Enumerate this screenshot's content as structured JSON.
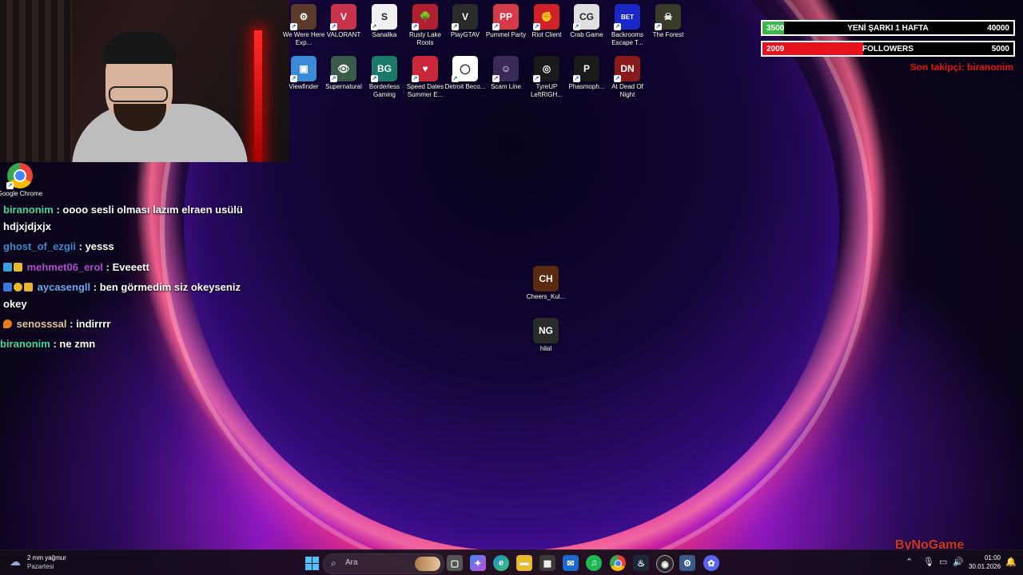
{
  "desktop_icons": [
    {
      "label": "We Were Here Exp...",
      "color": "#5a3a2a",
      "glyph": "⚙"
    },
    {
      "label": "VALORANT",
      "color": "#c8324a",
      "glyph": "V"
    },
    {
      "label": "Sanalika",
      "color": "#f0f0f0",
      "glyph": "S"
    },
    {
      "label": "Rusty Lake Roots",
      "color": "#b02030",
      "glyph": "🌳"
    },
    {
      "label": "PlayGTAV",
      "color": "#2a2a2a",
      "glyph": "V"
    },
    {
      "label": "Pummel Party",
      "color": "#d63a4a",
      "glyph": "PP"
    },
    {
      "label": "Riot Client",
      "color": "#d0202a",
      "glyph": "✊"
    },
    {
      "label": "Crab Game",
      "color": "#e0e0e0",
      "glyph": "CG"
    },
    {
      "label": "Backrooms Escape T...",
      "color": "#1828c8",
      "glyph": "BET"
    },
    {
      "label": "The Forest",
      "color": "#3a3a2a",
      "glyph": "☠"
    },
    {
      "label": "Viewfinder",
      "color": "#3a8ad8",
      "glyph": "▣"
    },
    {
      "label": "Supernatural",
      "color": "#3a5a4a",
      "glyph": "👁"
    },
    {
      "label": "Borderless Gaming",
      "color": "#1a7a6a",
      "glyph": "BG"
    },
    {
      "label": "Speed Dates Summer E...",
      "color": "#c8283a",
      "glyph": "♥"
    },
    {
      "label": "Detroit Beco...",
      "color": "#ffffff",
      "glyph": "◯"
    },
    {
      "label": "Scam Line",
      "color": "#3a2a5a",
      "glyph": "☺"
    },
    {
      "label": "TyreUP LeftRIGH...",
      "color": "#1a1a1a",
      "glyph": "◎"
    },
    {
      "label": "Phasmoph...",
      "color": "#1a1a1a",
      "glyph": "P"
    },
    {
      "label": "At Dead Of Night",
      "color": "#8a1a1a",
      "glyph": "DN"
    },
    {
      "label": "Google Chrome",
      "color": "#ffffff",
      "glyph": "●"
    },
    {
      "label": "Cheers_Kul...",
      "color": "#5a2a10",
      "glyph": "CH"
    },
    {
      "label": "hilal",
      "color": "#2a2a2a",
      "glyph": "NG"
    }
  ],
  "chat": [
    {
      "user": "biranonim",
      "user_color": "#3fd6a8",
      "text": ": oooo sesli olması lazım elraen usülü hdjxjdjxjx",
      "badges": []
    },
    {
      "user": "ghost_of_ezgii",
      "user_color": "#3a8ad8",
      "text": ": yesss",
      "badges": []
    },
    {
      "user": "mehmet06_erol",
      "user_color": "#b04ad8",
      "text": ": Eveeett",
      "badges": [
        "drop",
        "crown"
      ]
    },
    {
      "user": "aycasengll",
      "user_color": "#6aa8f0",
      "text": ": ben görmedim siz okeyseniz okey",
      "badges": [
        "arrow",
        "one",
        "crown"
      ]
    },
    {
      "user": "senosssal",
      "user_color": "#e0c8a0",
      "text": ": indirrrr",
      "badges": [
        "fire"
      ]
    },
    {
      "user": "biranonim",
      "user_color": "#3fd6a8",
      "text": ": ne zmn",
      "badges": []
    }
  ],
  "goals": [
    {
      "current": "3500",
      "title": "YENİ ŞARKI 1 HAFTA",
      "target": "40000",
      "progress": 0.0875,
      "color": "#3ab84a"
    },
    {
      "current": "2009",
      "title": "FOLLOWERS",
      "target": "5000",
      "progress": 0.4018,
      "color": "#e8121c"
    }
  ],
  "last_follower": "Son takipçi: biranonim",
  "taskbar": {
    "weather_temp": "2 mm yağmur",
    "weather_day": "Pazartesi",
    "search_placeholder": "Ara",
    "time": "01:00",
    "date": "30.01.2026",
    "apps": [
      {
        "name": "windows-start",
        "color": "#3aa0f0",
        "glyph": "⊞"
      },
      {
        "name": "task-view",
        "color": "#555",
        "glyph": "▢"
      },
      {
        "name": "copilot",
        "color": "#6a4ad8",
        "glyph": "✦"
      },
      {
        "name": "edge",
        "color": "#1a8ad0",
        "glyph": "e"
      },
      {
        "name": "file-explorer",
        "color": "#e8b830",
        "glyph": "▬"
      },
      {
        "name": "store",
        "color": "#3a3a3a",
        "glyph": "▦"
      },
      {
        "name": "mail",
        "color": "#1a6ad0",
        "glyph": "✉"
      },
      {
        "name": "spotify",
        "color": "#1db954",
        "glyph": "♫"
      },
      {
        "name": "chrome",
        "color": "#e8e8e8",
        "glyph": "●"
      },
      {
        "name": "steam",
        "color": "#1b2838",
        "glyph": "♨"
      },
      {
        "name": "obs",
        "color": "#2a2a2a",
        "glyph": "◉"
      },
      {
        "name": "settings-app",
        "color": "#3a5a8a",
        "glyph": "⚙"
      },
      {
        "name": "discord",
        "color": "#5865f2",
        "glyph": "✿"
      }
    ]
  },
  "watermark": "ByNoGame"
}
